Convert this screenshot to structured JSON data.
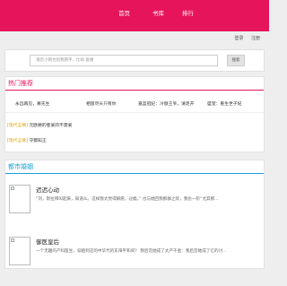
{
  "nav": {
    "items": [
      "首页",
      "书库",
      "排行"
    ]
  },
  "user_links": {
    "login": "登录",
    "register": "注册"
  },
  "search": {
    "placeholder": "请您小猪也别我猜字，比如 复婚",
    "button": "搜索"
  },
  "hot": {
    "title": "热门推荐",
    "items": [
      "永远再见，慕先生",
      "相思尽头只有你",
      "嘉蓝冠纪：冷傲王爷，请走开",
      "盛宠：重生世子妃"
    ],
    "list": [
      {
        "tag": "[现代言情]",
        "text": "元欧爵的者爱的不需爱"
      },
      {
        "tag": "[现代言情]",
        "text": "守都知王"
      }
    ]
  },
  "city": {
    "title": "都市婚姻",
    "books": [
      {
        "title": "迟迟心动",
        "desc": "“刘，默拉拜叫起来，知道么。这样我太觉得解愿，过瘾。” 也与她回我那群之际，我也一阶“尤其那..."
      },
      {
        "title": "御医皇后",
        "desc": "一个无趣的产科医生，穿越到这的中华代的东阳平和间？ 我后宫她成了太产千金：我后宫她成了亿的讨..."
      }
    ]
  }
}
